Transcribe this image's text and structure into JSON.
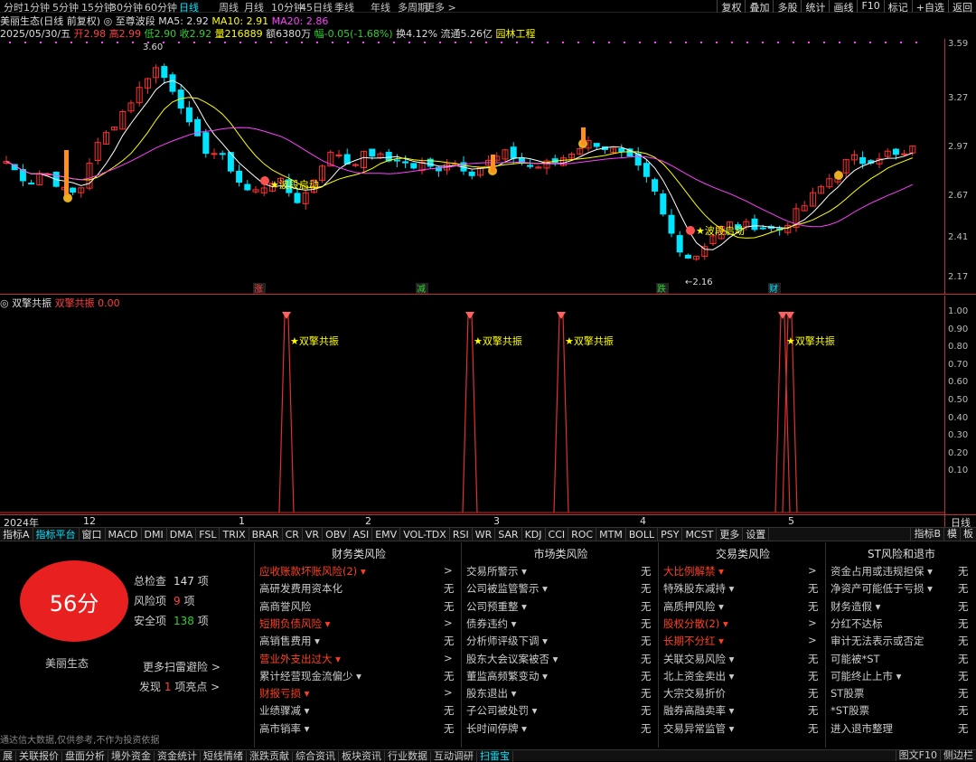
{
  "period_tabs": [
    "分时",
    "1分钟",
    "5分钟",
    "15分钟",
    "30分钟",
    "60分钟",
    "日线",
    "周线",
    "月线",
    "10分钟",
    "45日线",
    "季线",
    "年线",
    "多周期",
    "更多 >"
  ],
  "active_period": "日线",
  "right_buttons": [
    "复权",
    "叠加",
    "多股",
    "统计",
    "画线",
    "F10",
    "标记",
    "+自选",
    "返回"
  ],
  "stock": {
    "name_line": "美丽生态(日线 前复权)",
    "indicator": "至尊波段",
    "ma5": "MA5: 2.92",
    "ma10": "MA10: 2.91",
    "ma20": "MA20: 2.86",
    "date": "2025/05/30/五",
    "open": "开2.98",
    "high": "高2.99",
    "low": "低2.90",
    "close": "收2.92",
    "volume": "量216889",
    "amount": "额6380万",
    "change": "幅-0.05(-1.68%)",
    "turnover": "换4.12%",
    "float": "流通5.26亿",
    "industry": "园林工程"
  },
  "price_axis": [
    "3.59",
    "3.27",
    "2.97",
    "2.67",
    "2.41",
    "2.17"
  ],
  "annotations": {
    "high_label": "3.60",
    "low_label": "2.16",
    "signal1": "波段启动",
    "signal2": "波段启动",
    "event_markers": [
      "涨",
      "减",
      "跌",
      "财"
    ]
  },
  "indicator2": {
    "title": "双擎共振",
    "name": "双擎共振",
    "value": "0.00",
    "signal_label": "双擎共振",
    "axis": [
      "1.00",
      "0.90",
      "0.80",
      "0.70",
      "0.60",
      "0.50",
      "0.40",
      "0.30",
      "0.20",
      "0.10"
    ]
  },
  "date_axis": [
    "2024年",
    "12",
    "1",
    "2",
    "3",
    "4",
    "5"
  ],
  "date_axis_right": "日线",
  "indicator_tabs": [
    "指标A",
    "指标平台",
    "窗口",
    "MACD",
    "DMI",
    "DMA",
    "FSL",
    "TRIX",
    "BRAR",
    "CR",
    "VR",
    "OBV",
    "ASI",
    "EMV",
    "VOL-TDX",
    "RSI",
    "WR",
    "SAR",
    "KDJ",
    "CCI",
    "ROC",
    "MTM",
    "BOLL",
    "PSY",
    "MCST",
    "更多",
    "设置"
  ],
  "indicator_tabs_right": [
    "指标B",
    "模",
    "板"
  ],
  "risk": {
    "score": "56分",
    "company": "美丽生态",
    "total_label": "总检查",
    "total_value": "147",
    "risk_label": "风险项",
    "risk_value": "9",
    "safe_label": "安全项",
    "safe_value": "138",
    "unit": "项",
    "more_link": "更多扫雷避险 >",
    "find_prefix": "发现",
    "find_count": "1",
    "find_suffix": "项亮点 >",
    "disclaimer": "通达信大数据,仅供参考,不作为投资依据",
    "columns": [
      {
        "title": "财务类风险",
        "items": [
          {
            "label": "应收账款坏账风险(2) ▾",
            "value": ">",
            "hi": true
          },
          {
            "label": "高研发费用资本化",
            "value": "无",
            "hi": false
          },
          {
            "label": "高商誉风险",
            "value": "无",
            "hi": false
          },
          {
            "label": "短期负债风险 ▾",
            "value": ">",
            "hi": true
          },
          {
            "label": "高销售费用 ▾",
            "value": "无",
            "hi": false
          },
          {
            "label": "营业外支出过大 ▾",
            "value": ">",
            "hi": true
          },
          {
            "label": "累计经营现金流偏少 ▾",
            "value": "无",
            "hi": false
          },
          {
            "label": "财报亏损 ▾",
            "value": ">",
            "hi": true
          },
          {
            "label": "业绩骤减 ▾",
            "value": "无",
            "hi": false
          },
          {
            "label": "高市销率 ▾",
            "value": "无",
            "hi": false
          }
        ]
      },
      {
        "title": "市场类风险",
        "items": [
          {
            "label": "交易所警示 ▾",
            "value": "无",
            "hi": false
          },
          {
            "label": "公司被监管警示 ▾",
            "value": "无",
            "hi": false
          },
          {
            "label": "公司预重整 ▾",
            "value": "无",
            "hi": false
          },
          {
            "label": "债券违约 ▾",
            "value": "无",
            "hi": false
          },
          {
            "label": "分析师评级下调 ▾",
            "value": "无",
            "hi": false
          },
          {
            "label": "股东大会议案被否 ▾",
            "value": "无",
            "hi": false
          },
          {
            "label": "董监高频繁变动 ▾",
            "value": "无",
            "hi": false
          },
          {
            "label": "股东退出 ▾",
            "value": "无",
            "hi": false
          },
          {
            "label": "子公司被处罚 ▾",
            "value": "无",
            "hi": false
          },
          {
            "label": "长时间停牌 ▾",
            "value": "无",
            "hi": false
          }
        ]
      },
      {
        "title": "交易类风险",
        "items": [
          {
            "label": "大比例解禁 ▾",
            "value": ">",
            "hi": true
          },
          {
            "label": "特殊股东减持 ▾",
            "value": "无",
            "hi": false
          },
          {
            "label": "高质押风险 ▾",
            "value": "无",
            "hi": false
          },
          {
            "label": "股权分散(2) ▾",
            "value": ">",
            "hi": true
          },
          {
            "label": "长期不分红 ▾",
            "value": ">",
            "hi": true
          },
          {
            "label": "关联交易风险 ▾",
            "value": "无",
            "hi": false
          },
          {
            "label": "北上资金卖出 ▾",
            "value": "无",
            "hi": false
          },
          {
            "label": "大宗交易折价",
            "value": "无",
            "hi": false
          },
          {
            "label": "融券高融卖率 ▾",
            "value": "无",
            "hi": false
          },
          {
            "label": "交易异常监管 ▾",
            "value": "无",
            "hi": false
          }
        ]
      },
      {
        "title": "ST风险和退市",
        "items": [
          {
            "label": "资金占用或违规担保 ▾",
            "value": "无",
            "hi": false
          },
          {
            "label": "净资产可能低于亏损 ▾",
            "value": "无",
            "hi": false
          },
          {
            "label": "财务造假 ▾",
            "value": "无",
            "hi": false
          },
          {
            "label": "分红不达标",
            "value": "无",
            "hi": false
          },
          {
            "label": "审计无法表示或否定",
            "value": "无",
            "hi": false
          },
          {
            "label": "可能被*ST",
            "value": "无",
            "hi": false
          },
          {
            "label": "可能终止上市 ▾",
            "value": "无",
            "hi": false
          },
          {
            "label": "ST股票",
            "value": "无",
            "hi": false
          },
          {
            "label": "*ST股票",
            "value": "无",
            "hi": false
          },
          {
            "label": "进入退市整理",
            "value": "无",
            "hi": false
          }
        ]
      }
    ]
  },
  "bottom_tabs": [
    "展",
    "关联报价",
    "盘面分析",
    "境外资金",
    "资金统计",
    "短线情绪",
    "涨跌贡献",
    "综合资讯",
    "板块资讯",
    "行业数据",
    "互动调研",
    "扫雷宝"
  ],
  "bottom_right": [
    "图文F10",
    "侧边栏"
  ],
  "colors": {
    "up": "#ff3030",
    "down": "#00e5ff",
    "ma5": "#ffffff",
    "ma10": "#ffff00",
    "ma20": "#ff40ff",
    "accent": "#00e5ff",
    "risk_red": "#ff4020",
    "score_bg": "#e8201f"
  }
}
